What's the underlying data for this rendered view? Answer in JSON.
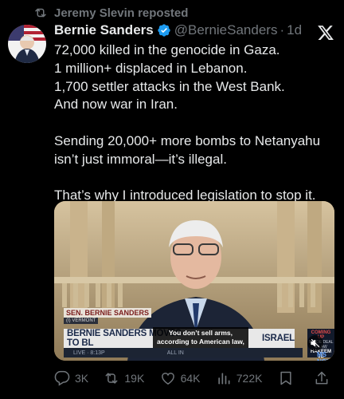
{
  "repost": {
    "label": "Jeremy Slevin reposted"
  },
  "author": {
    "name": "Bernie Sanders",
    "handle": "@BernieSanders",
    "separator": "·",
    "time": "1d"
  },
  "post": {
    "lines": [
      "72,000 killed in the genocide in Gaza.",
      "1 million+ displaced in Lebanon.",
      "1,700 settler attacks in the West Bank.",
      "And now war in Iran.",
      "",
      "Sending 20,000+ more bombs to Netanyahu",
      "isn’t just immoral—it’s illegal.",
      "",
      "That’s why I introduced legislation to stop it."
    ]
  },
  "video": {
    "name_tag": "SEN. BERNIE SANDERS",
    "state_tag": "(I) VERMONT",
    "banner": "BERNIE SANDERS MOVES TO BL",
    "banner_tail": "ISRAEL",
    "subtitle_line1": "You don’t sell arms,",
    "subtitle_line2": "according to American law,",
    "bottom_left": "LIVE · 8:13P",
    "bottom_mid": "ALL IN",
    "coming_up": "COMING UP",
    "coming_up_sub": "INSIDE DEAL & LAW",
    "coming_up_name": "HAKEEM JE",
    "network": "MS NOW"
  },
  "actions": {
    "replies": "3K",
    "reposts": "19K",
    "likes": "64K",
    "views": "722K"
  },
  "colors": {
    "background": "#000000",
    "text": "#e7e9ea",
    "muted": "#71767b",
    "verified": "#1d9bf0"
  },
  "icons": [
    "repost-icon",
    "verified-badge-icon",
    "x-logo-icon",
    "reply-icon",
    "like-icon",
    "views-icon",
    "bookmark-icon",
    "share-icon",
    "mute-icon"
  ]
}
